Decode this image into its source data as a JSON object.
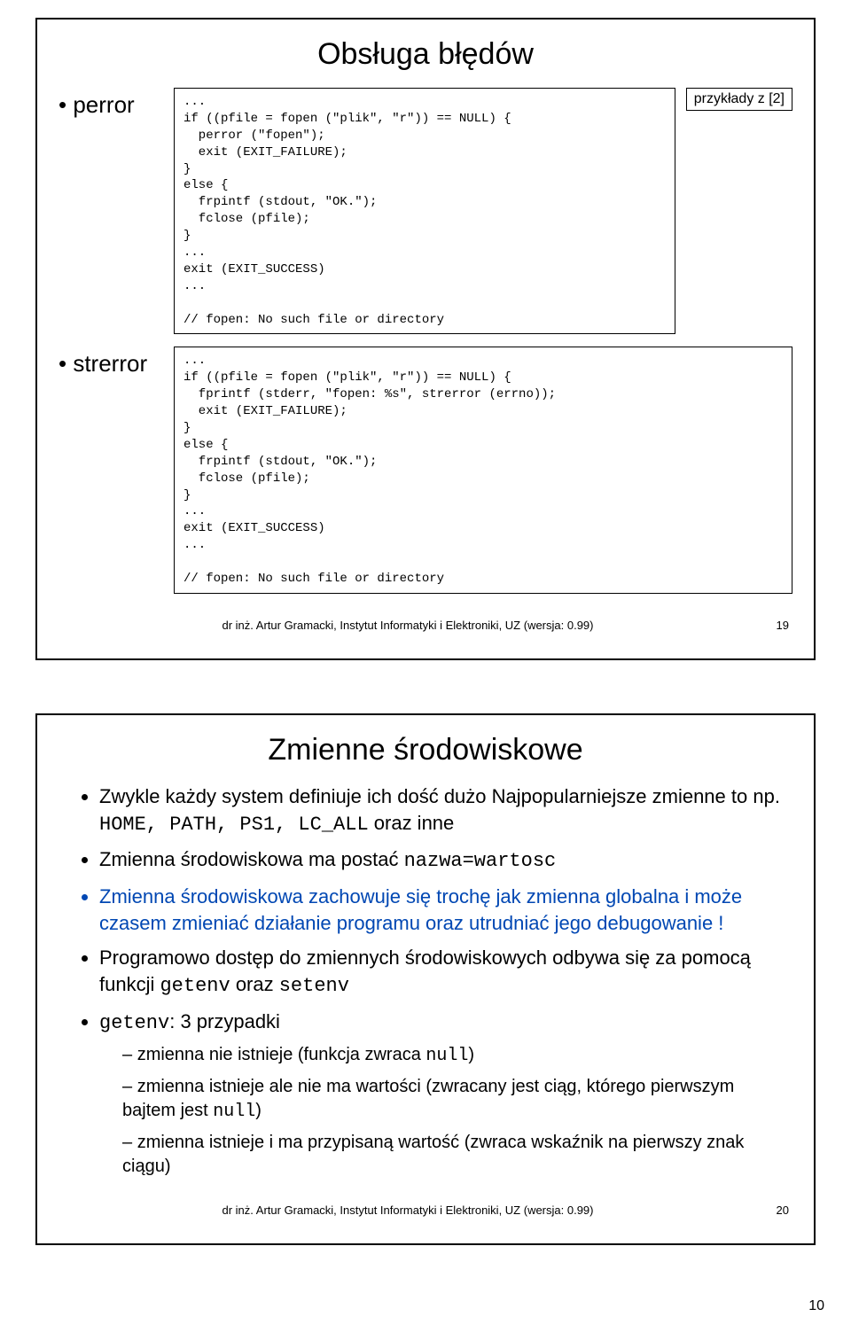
{
  "slide1": {
    "title": "Obsługa błędów",
    "leftBullet1": "perror",
    "leftBullet2": "strerror",
    "tag": "przykłady z [2]",
    "code1": "...\nif ((pfile = fopen (\"plik\", \"r\")) == NULL) {\n  perror (\"fopen\");\n  exit (EXIT_FAILURE);\n}\nelse {\n  frpintf (stdout, \"OK.\");\n  fclose (pfile);\n}\n...\nexit (EXIT_SUCCESS)\n...\n\n// fopen: No such file or directory",
    "code2": "...\nif ((pfile = fopen (\"plik\", \"r\")) == NULL) {\n  fprintf (stderr, \"fopen: %s\", strerror (errno));\n  exit (EXIT_FAILURE);\n}\nelse {\n  frpintf (stdout, \"OK.\");\n  fclose (pfile);\n}\n...\nexit (EXIT_SUCCESS)\n...\n\n// fopen: No such file or directory",
    "footer": "dr inż. Artur Gramacki, Instytut Informatyki i Elektroniki, UZ (wersja: 0.99)",
    "pageNum": "19"
  },
  "slide2": {
    "title": "Zmienne środowiskowe",
    "items": {
      "li1a": "Zwykle każdy system definiuje ich dość dużo Najpopularniejsze zmienne to np. ",
      "li1m": "HOME, PATH, PS1, LC_ALL",
      "li1b": " oraz inne",
      "li2a": "Zmienna środowiskowa ma postać ",
      "li2m": "nazwa=wartosc",
      "li3": "Zmienna środowiskowa zachowuje się trochę jak zmienna globalna i może czasem zmieniać działanie programu oraz utrudniać jego debugowanie !",
      "li4a": "Programowo dostęp do zmiennych środowiskowych odbywa się za pomocą funkcji ",
      "li4m1": "getenv",
      "li4b": " oraz ",
      "li4m2": "setenv",
      "li5m": "getenv",
      "li5a": ": 3 przypadki",
      "sub1a": "zmienna nie istnieje (funkcja zwraca ",
      "sub1m": "null",
      "sub1b": ")",
      "sub2a": "zmienna istnieje ale nie ma wartości (zwracany jest ciąg, którego pierwszym bajtem jest ",
      "sub2m": "null",
      "sub2b": ")",
      "sub3": "zmienna istnieje i ma przypisaną wartość (zwraca wskaźnik na pierwszy znak ciągu)"
    },
    "footer": "dr inż. Artur Gramacki, Instytut Informatyki i Elektroniki, UZ (wersja: 0.99)",
    "pageNum": "20"
  },
  "overallPage": "10"
}
